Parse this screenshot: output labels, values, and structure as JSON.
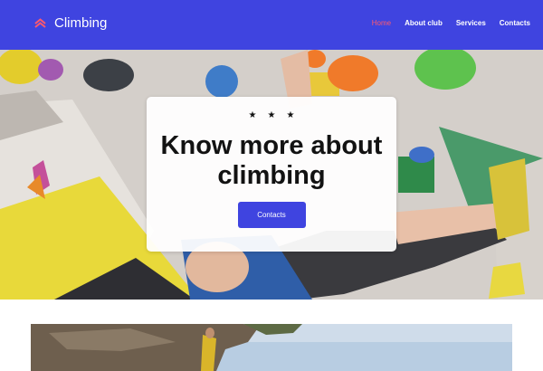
{
  "header": {
    "brand_name": "Climbing",
    "brand_icon": "double-chevron-up-icon",
    "nav": [
      {
        "label": "Home",
        "active": true
      },
      {
        "label": "About club",
        "active": false
      },
      {
        "label": "Services",
        "active": false
      },
      {
        "label": "Contacts",
        "active": false
      }
    ]
  },
  "hero": {
    "stars": [
      "★",
      "★",
      "★"
    ],
    "headline_line1": "Know more about",
    "headline_line2": "climbing",
    "button_label": "Contacts"
  },
  "colors": {
    "primary": "#3f44e0",
    "active_nav": "#ff5a6e",
    "card_bg": "#ffffff"
  }
}
